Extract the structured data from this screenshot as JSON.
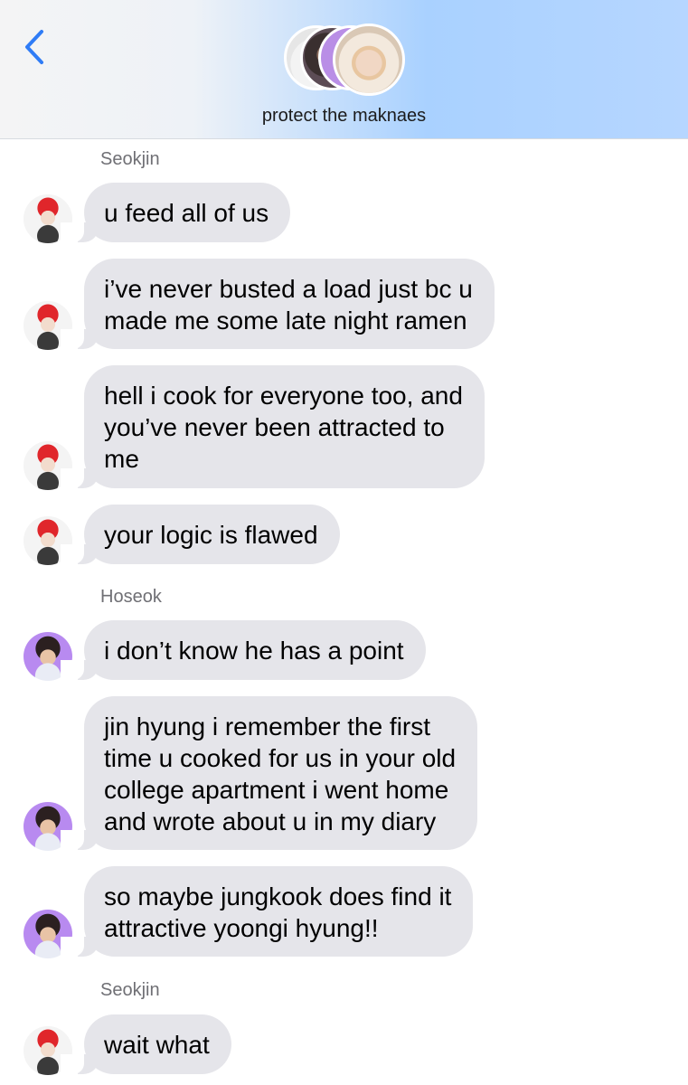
{
  "header": {
    "group_name": "protect the maknaes",
    "accent_color": "#2f7cf6",
    "back_icon": "chevron-left-icon"
  },
  "messages": [
    {
      "sender": "Seokjin"
    },
    {
      "text": "u feed all of us"
    },
    {
      "text": "i’ve never busted a load just bc u\nmade me some late night ramen"
    },
    {
      "text": "hell i cook for everyone too, and\nyou’ve never been attracted to\nme"
    },
    {
      "text": "your logic is flawed"
    },
    {
      "sender": "Hoseok"
    },
    {
      "text": "i don’t know he has a point"
    },
    {
      "text": "jin hyung i remember the first\ntime u cooked for us in your old\ncollege apartment i went home\nand wrote about u in my diary"
    },
    {
      "text": "so maybe jungkook does find it\nattractive yoongi hyung!!"
    },
    {
      "sender": "Seokjin"
    },
    {
      "text": "wait what"
    }
  ],
  "colors": {
    "bubble": "#e5e5ea",
    "sender_label": "#6f6f74"
  }
}
